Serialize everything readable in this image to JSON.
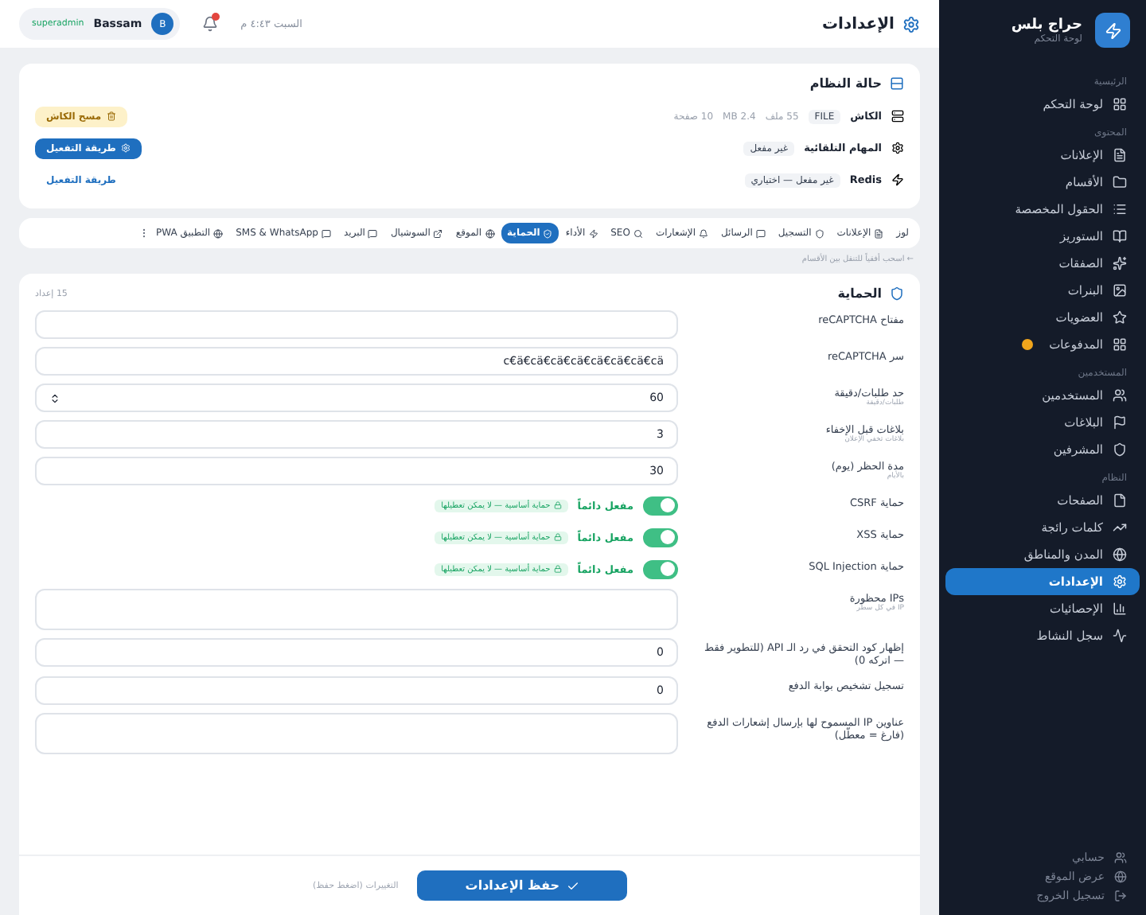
{
  "sidebar": {
    "brand": {
      "name": "حراج بلس",
      "subtitle": "لوحة التحكم"
    },
    "sections": [
      {
        "title": "الرئيسية",
        "items": [
          {
            "label": "لوحة التحكم",
            "selected": false
          }
        ]
      },
      {
        "title": "المحتوى",
        "items": [
          {
            "label": "الإعلانات",
            "selected": false
          },
          {
            "label": "الأقسام",
            "selected": false
          },
          {
            "label": "الحقول المخصصة",
            "selected": false
          },
          {
            "label": "الستوريز",
            "selected": false
          },
          {
            "label": "الصفقات",
            "selected": false
          },
          {
            "label": "البنرات",
            "selected": false
          },
          {
            "label": "العضويات",
            "selected": false
          },
          {
            "label": "المدفوعات",
            "selected": false,
            "badge": true
          }
        ]
      },
      {
        "title": "المستخدمين",
        "items": [
          {
            "label": "المستخدمين",
            "selected": false
          },
          {
            "label": "البلاغات",
            "selected": false
          },
          {
            "label": "المشرفين",
            "selected": false
          }
        ]
      },
      {
        "title": "النظام",
        "items": [
          {
            "label": "الصفحات",
            "selected": false
          },
          {
            "label": "كلمات رائجة",
            "selected": false
          },
          {
            "label": "المدن والمناطق",
            "selected": false
          },
          {
            "label": "الإعدادات",
            "selected": true
          },
          {
            "label": "الإحصائيات",
            "selected": false
          },
          {
            "label": "سجل النشاط",
            "selected": false
          }
        ]
      }
    ],
    "footer": [
      "حسابي",
      "عرض الموقع",
      "تسجيل الخروج"
    ]
  },
  "header": {
    "title": "الإعدادات",
    "date": "السبت ٤:٤٣ م",
    "notifications": true,
    "user": {
      "initial": "B",
      "name": "Bassam",
      "role": "superadmin"
    }
  },
  "system_status": {
    "title": "حالة النظام",
    "rows": [
      {
        "label": "الكاش",
        "tags": [
          "FILE"
        ],
        "details": [
          "55 ملف",
          "2.4 MB",
          "10 صفحة"
        ],
        "action": {
          "label": "مسح الكاش",
          "kind": "warning"
        }
      },
      {
        "label": "المهام التلقائية",
        "tags": [
          "غير مفعل"
        ],
        "details": [],
        "action": {
          "label": "طريقة التفعيل",
          "kind": "primary"
        }
      },
      {
        "label": "Redis",
        "tags": [
          "غير مفعل — اختياري"
        ],
        "details": [],
        "action": {
          "label": "طريقة التفعيل",
          "kind": "link"
        }
      }
    ]
  },
  "tabs": [
    {
      "label": "لوز",
      "selected": false
    },
    {
      "label": "الإعلانات",
      "selected": false
    },
    {
      "label": "التسجيل",
      "selected": false
    },
    {
      "label": "الرسائل",
      "selected": false
    },
    {
      "label": "الإشعارات",
      "selected": false
    },
    {
      "label": "SEO",
      "selected": false
    },
    {
      "label": "الأداء",
      "selected": false
    },
    {
      "label": "الحماية",
      "selected": true
    },
    {
      "label": "الموقع",
      "selected": false
    },
    {
      "label": "السوشيال",
      "selected": false
    },
    {
      "label": "البريد",
      "selected": false
    },
    {
      "label": "SMS & WhatsApp",
      "selected": false
    },
    {
      "label": "التطبيق PWA",
      "selected": false
    }
  ],
  "tabs_hint": "← اسحب أفقياً للتنقل بين الأقسام",
  "section": {
    "title": "الحماية",
    "count": "15 إعداد",
    "fields": [
      {
        "kind": "text",
        "label": "مفتاح reCAPTCHA"
      },
      {
        "kind": "text",
        "label": "سر reCAPTCHA",
        "value": "c€ä€cä€cä€cä€cä€cä€cä€cä"
      },
      {
        "kind": "number",
        "label": "حد طلبات/دقيقة",
        "hint": "طلبات/دقيقة",
        "value": "60"
      },
      {
        "kind": "text",
        "label": "بلاغات قبل الإخفاء",
        "hint": "بلاغات تخفي الإعلان",
        "value": "3"
      },
      {
        "kind": "text",
        "label": "مدة الحظر (يوم)",
        "hint": "بالأيام",
        "value": "30"
      },
      {
        "kind": "toggle",
        "label": "حماية CSRF",
        "on": true,
        "state": "مفعل دائماً",
        "note": "حماية أساسية — لا يمكن تعطيلها"
      },
      {
        "kind": "toggle",
        "label": "حماية XSS",
        "on": true,
        "state": "مفعل دائماً",
        "note": "حماية أساسية — لا يمكن تعطيلها"
      },
      {
        "kind": "toggle",
        "label": "حماية SQL Injection",
        "on": true,
        "state": "مفعل دائماً",
        "note": "حماية أساسية — لا يمكن تعطيلها"
      },
      {
        "kind": "textarea",
        "label": "IPs محظورة",
        "hint": "IP في كل سطر"
      },
      {
        "kind": "text",
        "label": "إظهار كود التحقق في رد الـ API (للتطوير فقط — اتركه 0)",
        "value": "0"
      },
      {
        "kind": "text",
        "label": "تسجيل تشخيص بوابة الدفع",
        "value": "0"
      },
      {
        "kind": "textarea",
        "label": "عناوين IP المسموح لها بإرسال إشعارات الدفع (فارغ = معطّل)"
      }
    ]
  },
  "save": {
    "label": "حفظ الإعدادات",
    "note": "التغييرات (اضغط حفظ)"
  }
}
